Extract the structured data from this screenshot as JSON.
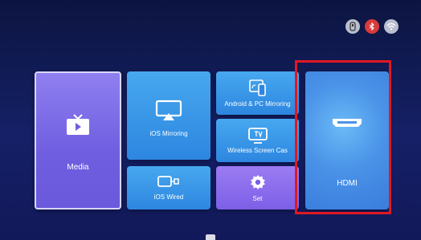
{
  "status_bar": {
    "icons": [
      "usb-icon",
      "bluetooth-icon",
      "wifi-icon"
    ],
    "colors": {
      "usb": "#b9bfcf",
      "bluetooth": "#d93b3b",
      "wifi": "#b9bfcf"
    }
  },
  "tiles": {
    "media": {
      "label": "Media",
      "icon": "tv-play-icon"
    },
    "ios_mirroring": {
      "label": "iOS Mirroring",
      "icon": "airplay-icon"
    },
    "ios_wired": {
      "label": "iOS Wired",
      "icon": "cable-icon"
    },
    "android_pc": {
      "label": "Android & PC Mirroring",
      "icon": "phone-cast-icon"
    },
    "wireless_cast": {
      "label": "Wireless Screen Cas",
      "icon": "tv-icon"
    },
    "set": {
      "label": "Set",
      "icon": "gear-icon"
    },
    "hdmi": {
      "label": "HDMI",
      "icon": "hdmi-port-icon"
    }
  },
  "selection": {
    "highlighted": "HDMI",
    "color": "#e01822"
  }
}
